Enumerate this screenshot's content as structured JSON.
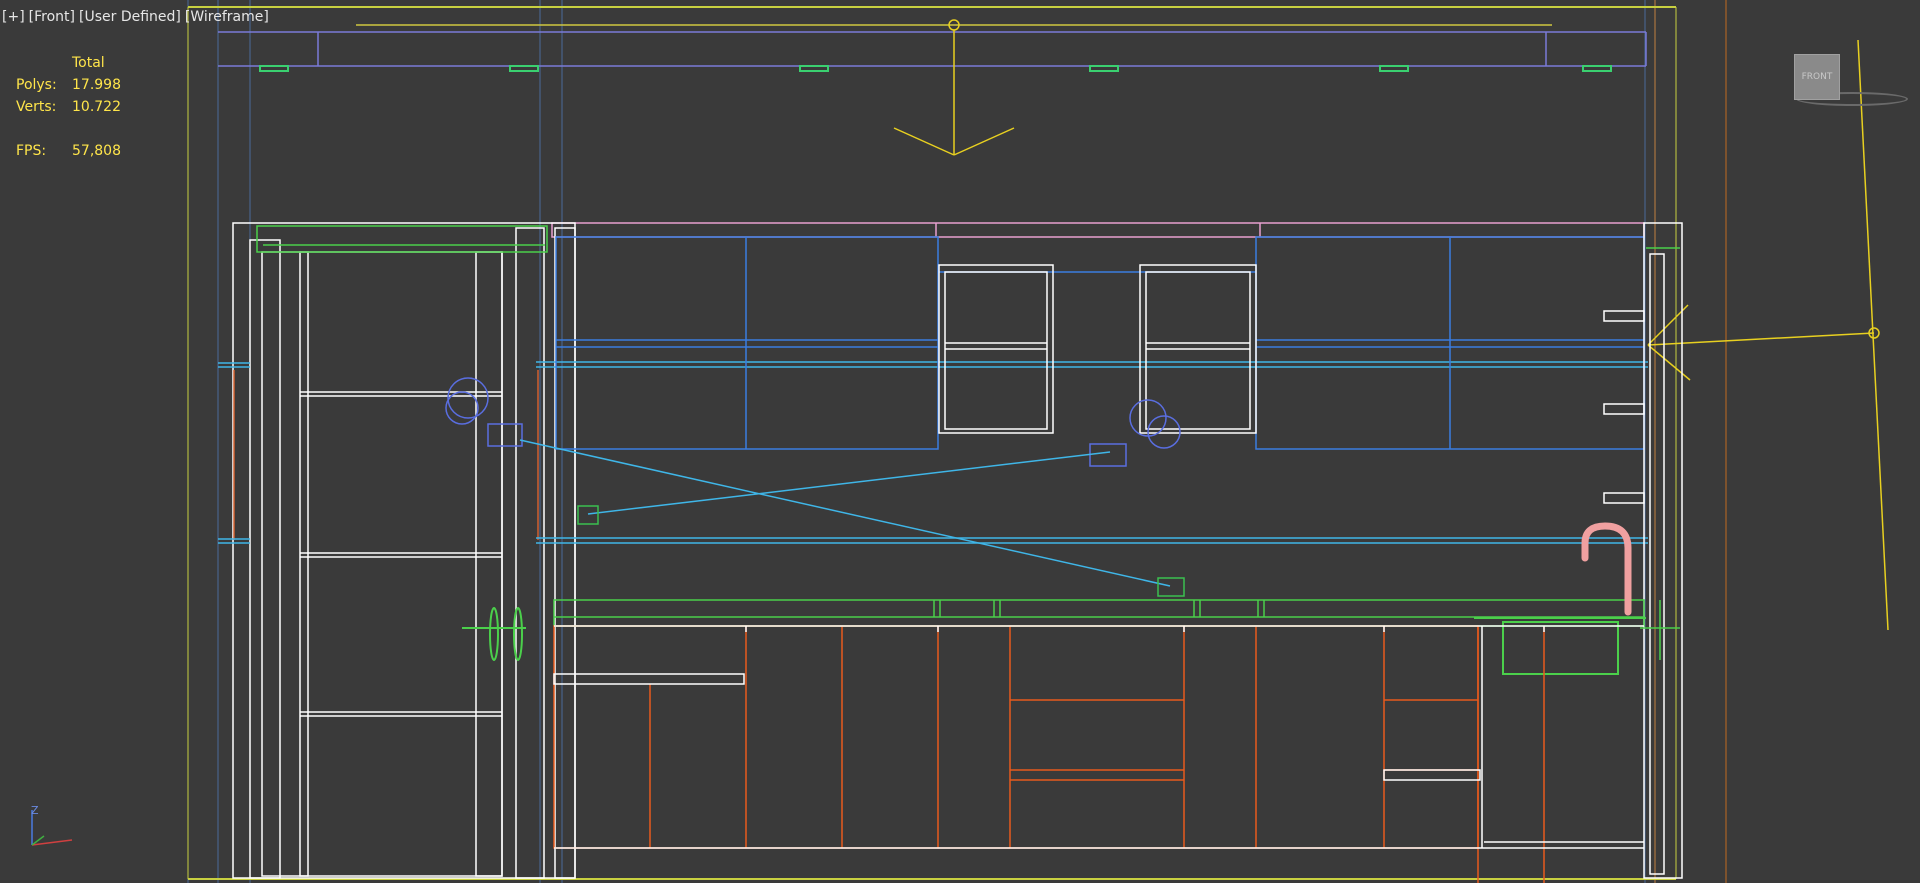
{
  "viewport": {
    "labels": {
      "plus": "[+]",
      "view": "[Front]",
      "shading_preset": "[User Defined]",
      "shading_mode": "[Wireframe]"
    }
  },
  "statistics": {
    "column_header": "Total",
    "polys_label": "Polys:",
    "polys_value": "17.998",
    "verts_label": "Verts:",
    "verts_value": "10.722",
    "fps_label": "FPS:",
    "fps_value": "57,808"
  },
  "viewcube": {
    "face_label": "FRONT"
  },
  "axis_gizmo": {
    "z_label": "Z"
  },
  "colors": {
    "background": "#3a3a3a",
    "stats_text": "#ffe54a",
    "wire_white": "#ffffff",
    "wire_blue": "#3a7de0",
    "wire_cyan": "#3fb6e8",
    "wire_green": "#4bd04b",
    "wire_orange": "#e85a1c",
    "wire_yellow": "#e0d020",
    "wire_pink": "#e8a0c0",
    "light_gizmo": "#5a6ee0"
  }
}
